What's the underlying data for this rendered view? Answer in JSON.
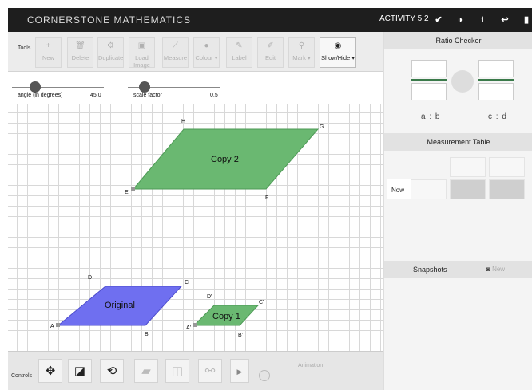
{
  "header": {
    "app_title": "CORNERSTONE MATHEMATICS",
    "activity": "ACTIVITY 5.2",
    "buttons": [
      {
        "icon": "check-icon",
        "glyph": "✔"
      },
      {
        "icon": "contrast-icon",
        "glyph": "◑"
      },
      {
        "icon": "info-icon",
        "glyph": "i"
      },
      {
        "icon": "back-arrow-icon",
        "glyph": "↩"
      },
      {
        "icon": "book-icon",
        "glyph": "▮"
      }
    ]
  },
  "toolbar": {
    "label": "Tools",
    "tools": [
      {
        "label": "New",
        "icon": "+"
      },
      {
        "label": "Delete",
        "icon": "🗑"
      },
      {
        "label": "Duplicate",
        "icon": "⚙"
      },
      {
        "label": "Load Image",
        "icon": "▣"
      },
      {
        "label": "Measure",
        "icon": "⟋"
      },
      {
        "label": "Colour ▾",
        "icon": "●"
      },
      {
        "label": "Label",
        "icon": "✎"
      },
      {
        "label": "Edit",
        "icon": "✐"
      },
      {
        "label": "Mark ▾",
        "icon": "⚲"
      },
      {
        "label": "Show/Hide ▾",
        "icon": "◉"
      }
    ]
  },
  "sliders": {
    "angle_label": "angle (in degrees)",
    "angle_value": "45.0",
    "scale_label": "scale factor",
    "scale_value": "0.5"
  },
  "canvas": {
    "copy2_label": "Copy 2",
    "original_label": "Original",
    "copy1_label": "Copy 1",
    "vertices": {
      "H": "H",
      "G": "G",
      "E": "E",
      "F": "F",
      "D": "D",
      "C": "C",
      "A": "A",
      "B": "B",
      "Dp": "D'",
      "Cp": "C'",
      "Ap": "A'",
      "Bp": "B'"
    },
    "colors": {
      "copy_fill": "#6ab871",
      "original_fill": "#6f6ff0"
    }
  },
  "controls": {
    "label": "Controls",
    "animation_label": "Animation",
    "buttons": [
      {
        "icon": "move-icon",
        "glyph": "✥",
        "disabled": false
      },
      {
        "icon": "scale-icon",
        "glyph": "◪",
        "disabled": false
      },
      {
        "icon": "rotate-icon",
        "glyph": "⟲",
        "disabled": false
      },
      {
        "icon": "shear-icon",
        "glyph": "▰",
        "disabled": true
      },
      {
        "icon": "reflect-icon",
        "glyph": "◫",
        "disabled": true
      },
      {
        "icon": "link-icon",
        "glyph": "⚯",
        "disabled": true
      }
    ]
  },
  "ratio_checker": {
    "title": "Ratio Checker",
    "left_label": "a : b",
    "right_label": "c : d"
  },
  "measurement_table": {
    "title": "Measurement Table",
    "now_label": "Now"
  },
  "snapshots": {
    "title": "Snapshots",
    "new_label": "New"
  }
}
